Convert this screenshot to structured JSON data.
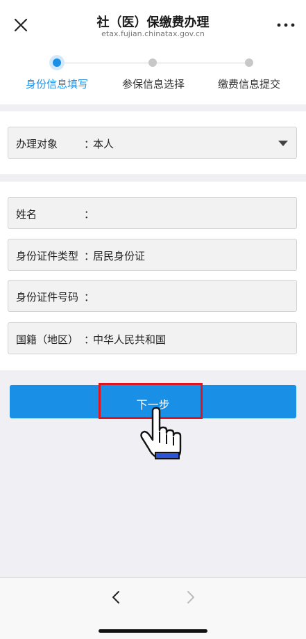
{
  "header": {
    "title": "社（医）保缴费办理",
    "subtitle": "etax.fujian.chinatax.gov.cn",
    "close_icon": "close-icon",
    "more_icon": "more-dots-icon"
  },
  "steps": [
    {
      "label": "身份信息填写",
      "active": true
    },
    {
      "label": "参保信息选择",
      "active": false
    },
    {
      "label": "缴费信息提交",
      "active": false
    }
  ],
  "subject": {
    "label": "办理对象",
    "colon": "：",
    "value": "本人"
  },
  "form": {
    "name": {
      "label": "姓名",
      "colon": "：",
      "value": ""
    },
    "id_type": {
      "label": "身份证件类型",
      "colon": "：",
      "value": "居民身份证"
    },
    "id_number": {
      "label": "身份证件号码",
      "colon": "：",
      "value": ""
    },
    "nationality": {
      "label": "国籍（地区）",
      "colon": "：",
      "value": "中华人民共和国"
    }
  },
  "next_button": {
    "label": "下一步"
  },
  "colors": {
    "accent": "#1a8fe6",
    "highlight": "#e0141e"
  },
  "nav": {
    "back_icon": "chevron-left-icon",
    "forward_icon": "chevron-right-icon"
  }
}
